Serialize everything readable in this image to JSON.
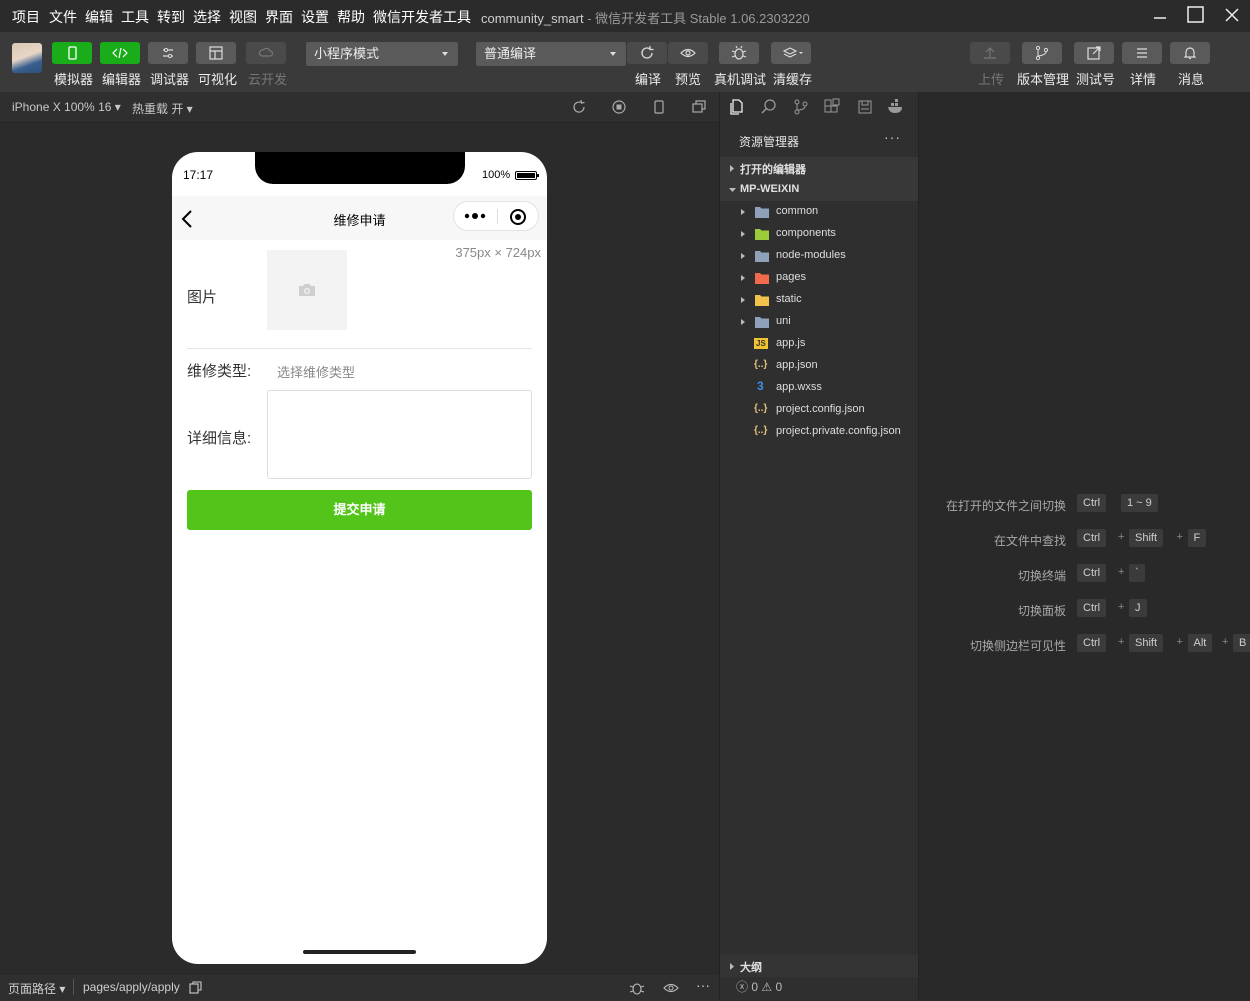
{
  "menu": [
    "项目",
    "文件",
    "编辑",
    "工具",
    "转到",
    "选择",
    "视图",
    "界面",
    "设置",
    "帮助",
    "微信开发者工具"
  ],
  "window": {
    "project": "community_smart",
    "app_title": "- 微信开发者工具 Stable 1.06.2303220"
  },
  "toolbar": {
    "simulator": "模拟器",
    "editor": "编辑器",
    "debugger": "调试器",
    "visualize": "可视化",
    "cloud": "云开发",
    "mode": "小程序模式",
    "compile_mode": "普通编译",
    "compile": "编译",
    "preview": "预览",
    "real_debug": "真机调试",
    "clear_cache": "清缓存",
    "upload": "上传",
    "version": "版本管理",
    "test_account": "测试号",
    "details": "详情",
    "messages": "消息"
  },
  "simbar": {
    "device": "iPhone X 100% 16",
    "hot_reload": "热重载 开"
  },
  "phone": {
    "time": "17:17",
    "battery": "100%",
    "nav_title": "维修申请",
    "size_tip": "375px × 724px",
    "label_image": "图片",
    "label_type": "维修类型:",
    "type_placeholder": "选择维修类型",
    "label_detail": "详细信息:",
    "submit": "提交申请"
  },
  "bottom": {
    "path_label": "页面路径",
    "path": "pages/apply/apply"
  },
  "explorer": {
    "header": "资源管理器",
    "more": "···",
    "open_editors": "打开的编辑器",
    "project": "MP-WEIXIN",
    "items": [
      {
        "name": "common",
        "folder": true,
        "icon_color": "#8fa1b8"
      },
      {
        "name": "components",
        "folder": true,
        "icon_color": "#9ccc3a"
      },
      {
        "name": "node-modules",
        "folder": true,
        "icon_color": "#8fa1b8"
      },
      {
        "name": "pages",
        "folder": true,
        "icon_color": "#f06a4b"
      },
      {
        "name": "static",
        "folder": true,
        "icon_color": "#f2c14e"
      },
      {
        "name": "uni",
        "folder": true,
        "icon_color": "#8fa1b8"
      },
      {
        "name": "app.js",
        "folder": false,
        "icon": "js-icon"
      },
      {
        "name": "app.json",
        "folder": false,
        "icon": "json-icon"
      },
      {
        "name": "app.wxss",
        "folder": false,
        "icon": "css-icon"
      },
      {
        "name": "project.config.json",
        "folder": false,
        "icon": "json-icon"
      },
      {
        "name": "project.private.config.json",
        "folder": false,
        "icon": "json-icon"
      }
    ],
    "outline": "大纲",
    "problems": "0",
    "warnings": "0"
  },
  "shortcuts": [
    {
      "label": "在打开的文件之间切换",
      "keys": [
        "Ctrl",
        "1 ~ 9"
      ],
      "joins": []
    },
    {
      "label": "在文件中查找",
      "keys": [
        "Ctrl",
        "Shift",
        "F"
      ]
    },
    {
      "label": "切换终端",
      "keys": [
        "Ctrl",
        "`"
      ]
    },
    {
      "label": "切换面板",
      "keys": [
        "Ctrl",
        "J"
      ]
    },
    {
      "label": "切换侧边栏可见性",
      "keys": [
        "Ctrl",
        "Shift",
        "Alt",
        "B"
      ]
    }
  ],
  "colors": {
    "accent_green": "#1aad19",
    "submit_green": "#52c41a"
  }
}
